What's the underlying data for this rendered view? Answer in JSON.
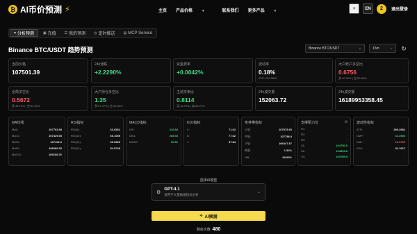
{
  "app": {
    "title": "AI币价预测",
    "logo_icon": "coin-icon",
    "bolt_icon": "bolt-icon"
  },
  "nav": [
    "主页",
    "产品价格",
    "联系我们",
    "更多产品"
  ],
  "header": {
    "lang": "EN",
    "avatar": "2",
    "logout": "退出登录"
  },
  "tabs": [
    {
      "label": "分析预测",
      "icon": "chart-icon",
      "active": true
    },
    {
      "label": "充值",
      "icon": "wallet-icon"
    },
    {
      "label": "我的预测",
      "icon": "list-icon"
    },
    {
      "label": "定时推送",
      "icon": "clock-icon"
    },
    {
      "label": "MCP Service",
      "icon": "server-icon"
    }
  ],
  "page_title": "Binance BTC/USDT 趋势预测",
  "pair_select": "Binance BTC/USDT",
  "interval_select": "15m",
  "stats_row1": [
    {
      "label": "当前价格",
      "value": "107501.39",
      "sub": ""
    },
    {
      "label": "24h涨跌",
      "value": "+2.2290%",
      "sub": "",
      "color": "green"
    },
    {
      "label": "资金费率",
      "value": "+0.0042%",
      "sub": "",
      "color": "green"
    },
    {
      "label": "波动率",
      "value": "0.18%",
      "sub": "ATR: 290.2682"
    },
    {
      "label": "大户账户多空比",
      "value": "0.6756",
      "sub": "多:40.32% | 空:59.68%",
      "color": "red"
    }
  ],
  "stats_row2": [
    {
      "label": "全局多空比",
      "value": "0.5672",
      "sub": "多:36.19% | 空:63.81%",
      "color": "red"
    },
    {
      "label": "大户持仓多空比",
      "value": "1.35",
      "sub": "多:57.47% | 空:42.53%",
      "color": "green"
    },
    {
      "label": "主动买卖比",
      "value": "0.8114",
      "sub": "买:44.79% | 卖:55.21%",
      "color": "green"
    },
    {
      "label": "24h成交量",
      "value": "152063.72",
      "sub": ""
    },
    {
      "label": "24h成交额",
      "value": "16189953358.45",
      "sub": ""
    }
  ],
  "indicators": [
    {
      "title": "MA均线",
      "rows": [
        [
          "MA5:",
          "107763.98"
        ],
        [
          "MA10:",
          "107429.93"
        ],
        [
          "MA20:",
          "107192.9"
        ],
        [
          "MA50:",
          "106689.25"
        ],
        [
          "MA200:",
          "105108.76"
        ]
      ]
    },
    {
      "title": "RSI指标",
      "rows": [
        [
          "RSI(6):",
          "63.6531"
        ],
        [
          "RSI(12):",
          "66.1005"
        ],
        [
          "RSI(14):",
          "60.5325"
        ],
        [
          "RSI(24):",
          "54.5749"
        ]
      ]
    },
    {
      "title": "MACD指标",
      "rows": [
        [
          "DIF:",
          "316.84"
        ],
        [
          "DEA:",
          "285.53"
        ],
        [
          "MACD:",
          "90.81"
        ]
      ]
    },
    {
      "title": "KDJ指标",
      "rows": [
        [
          "K:",
          "71.02"
        ],
        [
          "D:",
          "77.62"
        ],
        [
          "J:",
          "57.84"
        ]
      ]
    },
    {
      "title": "布林带指标",
      "rows": [
        [
          "上轨:",
          "107875.93"
        ],
        [
          "中轨:",
          "107758.9"
        ],
        [
          "下轨:",
          "106347.87"
        ],
        [
          "带宽:",
          "1.52%"
        ],
        [
          "%B:",
          "68.93%"
        ]
      ]
    },
    {
      "title": "支撑阻力位",
      "rows": [
        [
          "R1:",
          "-"
        ],
        [
          "R2:",
          "-"
        ],
        [
          "R3:",
          "-"
        ],
        [
          "S1:",
          "104750.9"
        ],
        [
          "S2:",
          "104529.8"
        ],
        [
          "S3:",
          "103789.9"
        ]
      ]
    },
    {
      "title": "波动性指标",
      "rows": [
        [
          "ATR:",
          "290.2682"
        ],
        [
          "DMI+:",
          "31.3904"
        ],
        [
          "DMI-:",
          "15.2733"
        ],
        [
          "ADX:",
          "32.1027"
        ]
      ]
    }
  ],
  "model": {
    "label": "选择AI模型",
    "name": "GPT-4.1",
    "desc": "适用于大量数据指标分析",
    "icon": "cpu-icon"
  },
  "predict_button": "AI预测",
  "remaining": {
    "label": "剩余次数:",
    "value": "480"
  }
}
